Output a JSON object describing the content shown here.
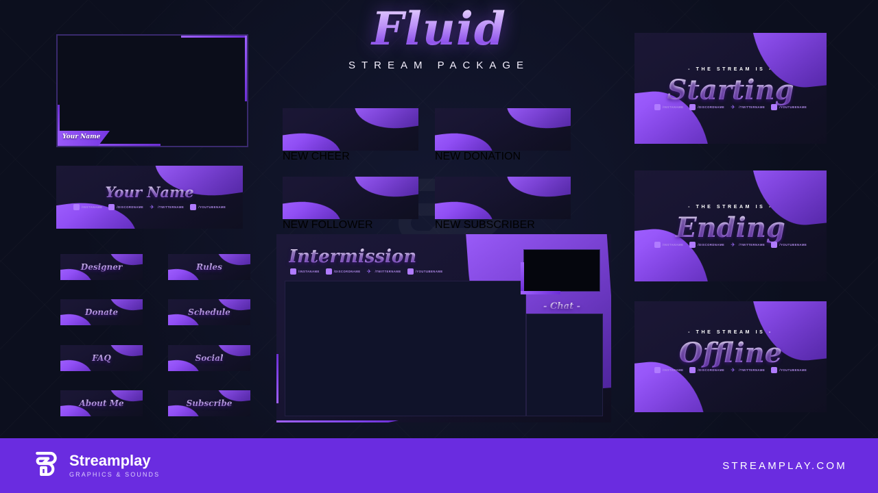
{
  "header": {
    "title": "Fluid",
    "subtitle": "STREAM PACKAGE"
  },
  "colors": {
    "background": "#0c0f1e",
    "panel_dark": "#171430",
    "accent_purple": "#8c4af2",
    "accent_light": "#a061ff",
    "footer": "#6a2ce0",
    "text_light": "#e2d2fb"
  },
  "socials": [
    {
      "icon": "instagram-icon",
      "handle": "/INSTANAME"
    },
    {
      "icon": "discord-icon",
      "handle": "/DISCORDNAME"
    },
    {
      "icon": "twitter-icon",
      "handle": "/TWITTERNAME"
    },
    {
      "icon": "youtube-icon",
      "handle": "/YOUTUBENAME"
    }
  ],
  "webcam": {
    "nametag": "Your Name"
  },
  "banner": {
    "name": "Your Name"
  },
  "alerts": [
    {
      "label": "NEW CHEER"
    },
    {
      "label": "NEW DONATION"
    },
    {
      "label": "NEW FOLLOWER"
    },
    {
      "label": "NEW SUBSCRIBER"
    }
  ],
  "panels": [
    {
      "label": "Designer"
    },
    {
      "label": "Rules"
    },
    {
      "label": "Donate"
    },
    {
      "label": "Schedule"
    },
    {
      "label": "FAQ"
    },
    {
      "label": "Social"
    },
    {
      "label": "About Me"
    },
    {
      "label": "Subscribe"
    }
  ],
  "intermission": {
    "title": "Intermission",
    "chat_label": "- Chat -"
  },
  "screens": [
    {
      "pretitle": "- THE STREAM IS -",
      "title": "Starting"
    },
    {
      "pretitle": "- THE STREAM IS -",
      "title": "Ending"
    },
    {
      "pretitle": "- THE STREAM IS -",
      "title": "Offline"
    }
  ],
  "footer": {
    "brand_name": "Streamplay",
    "brand_tagline": "GRAPHICS & SOUNDS",
    "url": "STREAMPLAY.COM"
  }
}
